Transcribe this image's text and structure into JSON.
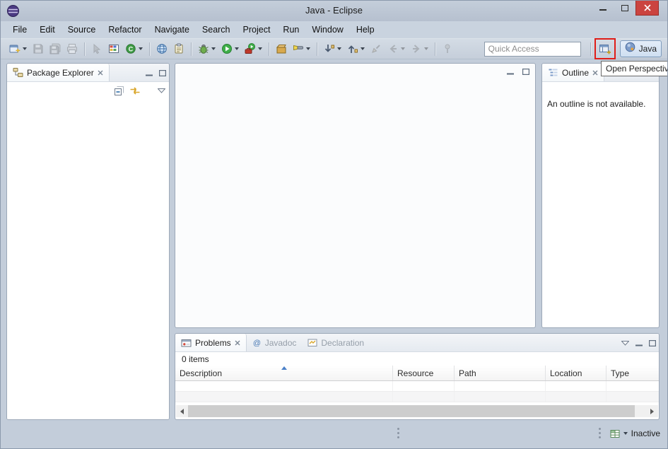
{
  "window": {
    "title": "Java - Eclipse"
  },
  "menu": {
    "items": [
      "File",
      "Edit",
      "Source",
      "Refactor",
      "Navigate",
      "Search",
      "Project",
      "Run",
      "Window",
      "Help"
    ]
  },
  "toolbar": {
    "quick_access": {
      "placeholder": "Quick Access"
    },
    "tooltip": "Open Perspective",
    "perspective": {
      "java_label": "Java"
    },
    "icons": [
      "new-wizard",
      "save",
      "save-all",
      "print",
      "mark-occurrences",
      "new-java-project",
      "new-java-class",
      "open-web-browser",
      "open-task",
      "debug",
      "run",
      "run-external-tools",
      "open-type",
      "search",
      "next-annotation",
      "previous-annotation",
      "last-edit-location",
      "back",
      "forward",
      "pin-editor",
      "open-perspective",
      "java-perspective"
    ],
    "accent_colors": {
      "annotation_red": "#e01d18",
      "run_green": "#3fae49",
      "selected_perspective_bg": "#d8e6f5"
    }
  },
  "package_explorer": {
    "title": "Package Explorer"
  },
  "outline": {
    "title": "Outline",
    "empty_message": "An outline is not available."
  },
  "problems": {
    "tabs": [
      "Problems",
      "Javadoc",
      "Declaration"
    ],
    "summary": "0 items",
    "columns": [
      "Description",
      "Resource",
      "Path",
      "Location",
      "Type"
    ]
  },
  "status": {
    "inactive_label": "Inactive"
  }
}
